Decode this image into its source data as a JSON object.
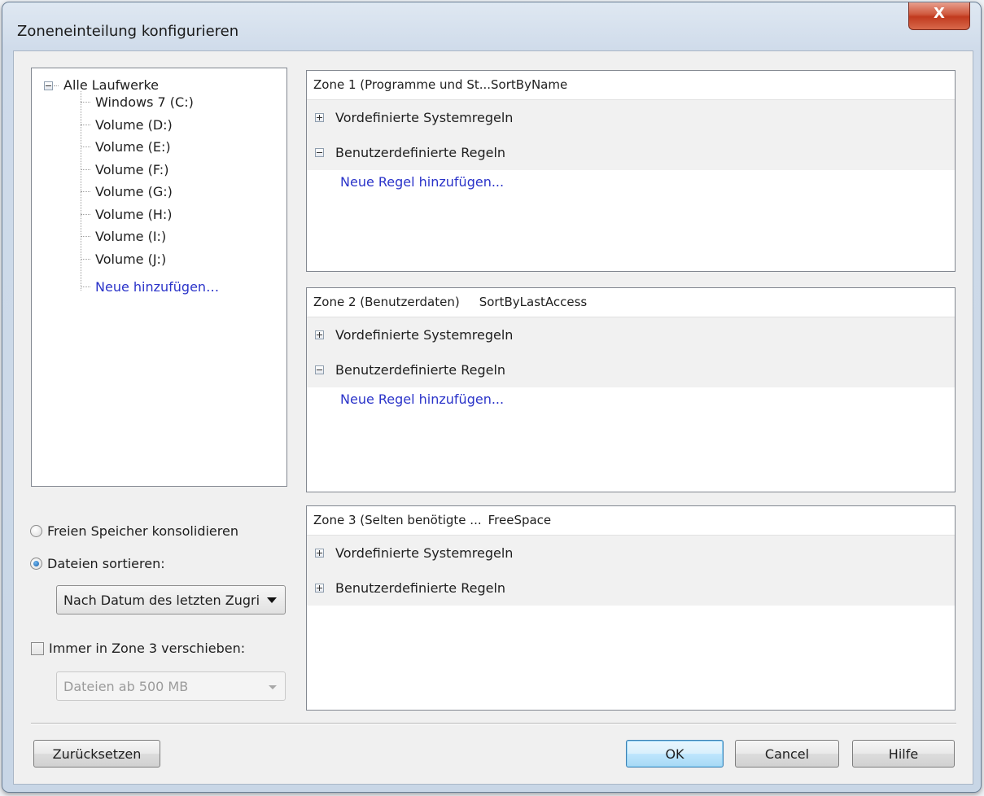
{
  "window": {
    "title": "Zoneneinteilung konfigurieren",
    "close_label": "X"
  },
  "tree": {
    "root": "Alle Laufwerke",
    "items": [
      "Windows 7 (C:)",
      "Volume (D:)",
      "Volume (E:)",
      "Volume (F:)",
      "Volume (G:)",
      "Volume (H:)",
      "Volume (I:)",
      "Volume (J:)"
    ],
    "add_link": "Neue hinzufügen…"
  },
  "zones": [
    {
      "header": "Zone 1 (Programme und St...SortByName",
      "sort": "",
      "rows": [
        {
          "label": "Vordefinierte Systemregeln",
          "expanded": false
        },
        {
          "label": "Benutzerdefinierte Regeln",
          "expanded": true
        }
      ],
      "link": "Neue Regel hinzufügen..."
    },
    {
      "header": "Zone 2 (Benutzerdaten)",
      "sort": "SortByLastAccess",
      "rows": [
        {
          "label": "Vordefinierte Systemregeln",
          "expanded": false
        },
        {
          "label": "Benutzerdefinierte Regeln",
          "expanded": true
        }
      ],
      "link": "Neue Regel hinzufügen..."
    },
    {
      "header": "Zone 3 (Selten benötigte ...",
      "sort": "FreeSpace",
      "rows": [
        {
          "label": "Vordefinierte Systemregeln",
          "expanded": false
        },
        {
          "label": "Benutzerdefinierte Regeln",
          "expanded": false
        }
      ],
      "link": ""
    }
  ],
  "options": {
    "radio_consolidate": "Freien Speicher konsolidieren",
    "radio_sort": "Dateien sortieren:",
    "selected_radio": "sort",
    "sort_select_value": "Nach Datum des letzten Zugri",
    "checkbox_move": "Immer in Zone 3 verschieben:",
    "checkbox_checked": false,
    "size_select_value": "Dateien ab 500 MB"
  },
  "buttons": {
    "reset": "Zurücksetzen",
    "ok": "OK",
    "cancel": "Cancel",
    "help": "Hilfe"
  },
  "colors": {
    "link": "#2a33c9",
    "close_button": "#c13a1f"
  }
}
